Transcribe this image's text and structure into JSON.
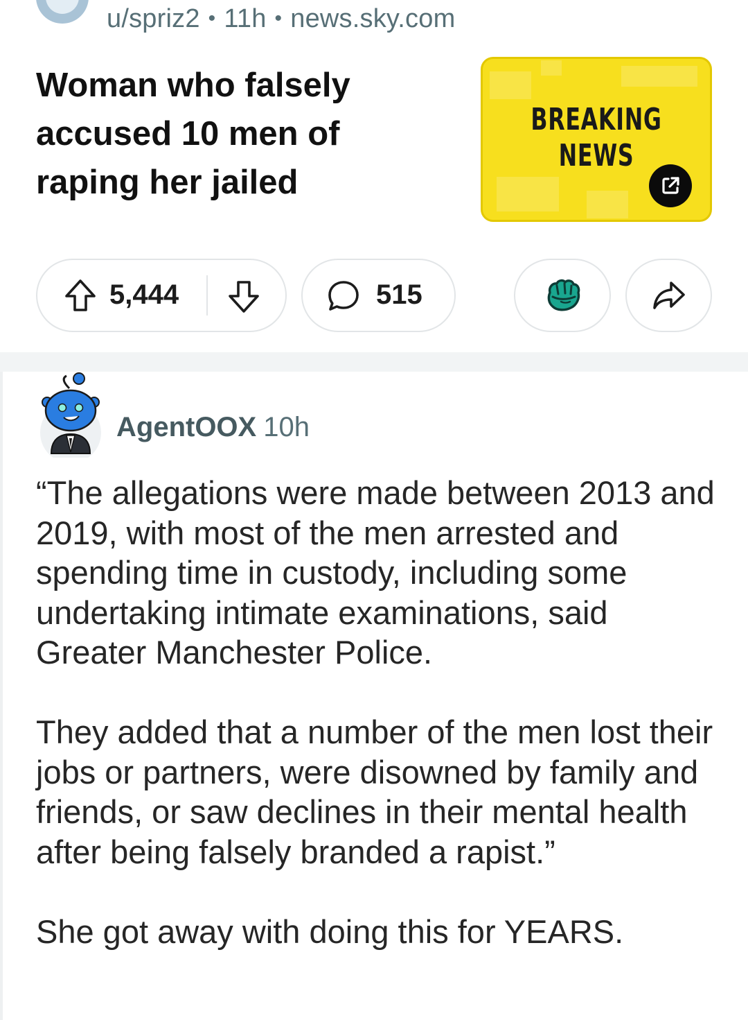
{
  "post": {
    "username": "u/spriz2",
    "age": "11h",
    "domain": "news.sky.com",
    "separator": "•",
    "title": "Woman who falsely accused 10 men of raping her jailed",
    "thumbnail": {
      "line1": "BREAKING",
      "line2": "NEWS",
      "background_color": "#f7df1e"
    }
  },
  "actions": {
    "vote_count": "5,444",
    "comment_count": "515",
    "upvote_icon": "upvote-arrow-icon",
    "downvote_icon": "downvote-arrow-icon",
    "comment_icon": "speech-bubble-icon",
    "award_icon": "award-fist-icon",
    "share_icon": "share-arrow-icon"
  },
  "comment": {
    "author": "AgentOOX",
    "age": "10h",
    "paragraphs": [
      "“The allegations were made between 2013 and 2019, with most of the men arrested and spending time in custody, including some undertaking intimate examinations, said Greater Manchester Police.",
      "They added that a number of the men lost their jobs or partners, were disowned by family and friends, or saw declines in their mental health after being falsely branded a rapist.”",
      "She got away with doing this for YEARS."
    ]
  }
}
